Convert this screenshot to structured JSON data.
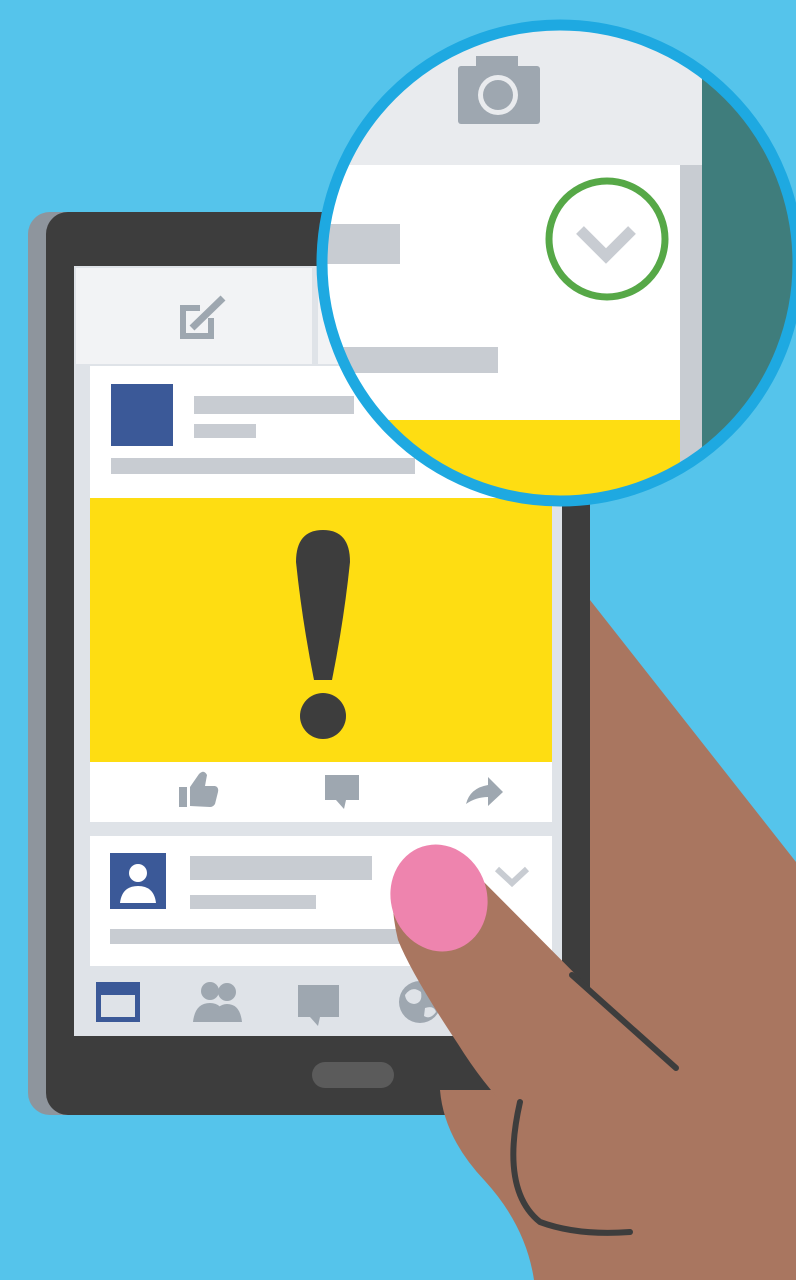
{
  "colors": {
    "background": "#55c4eb",
    "phone_body": "#3d3d3d",
    "phone_shadow": "#8e959d",
    "screen_bg": "#dfe3e8",
    "card_bg": "#ffffff",
    "placeholder": "#c8ccd2",
    "icon_grey": "#9ea7b0",
    "brand_blue": "#3b5998",
    "alert_yellow": "#fedd12",
    "alert_mark": "#3d3d3d",
    "skin": "#a97660",
    "nail": "#ee84ae",
    "magnifier_ring": "#1ea9e1",
    "teal_panel": "#3f7d7c",
    "check_green": "#56a847",
    "header_grey": "#e9ebee"
  },
  "icons": {
    "compose": "compose-icon",
    "camera": "camera-icon",
    "dropdown": "chevron-down-icon",
    "like": "thumbs-up-icon",
    "comment": "comment-icon",
    "share": "share-icon",
    "news_feed": "news-feed-icon",
    "friends": "friends-icon",
    "messages": "messages-icon",
    "notifications": "globe-icon",
    "warning": "exclamation-icon"
  }
}
